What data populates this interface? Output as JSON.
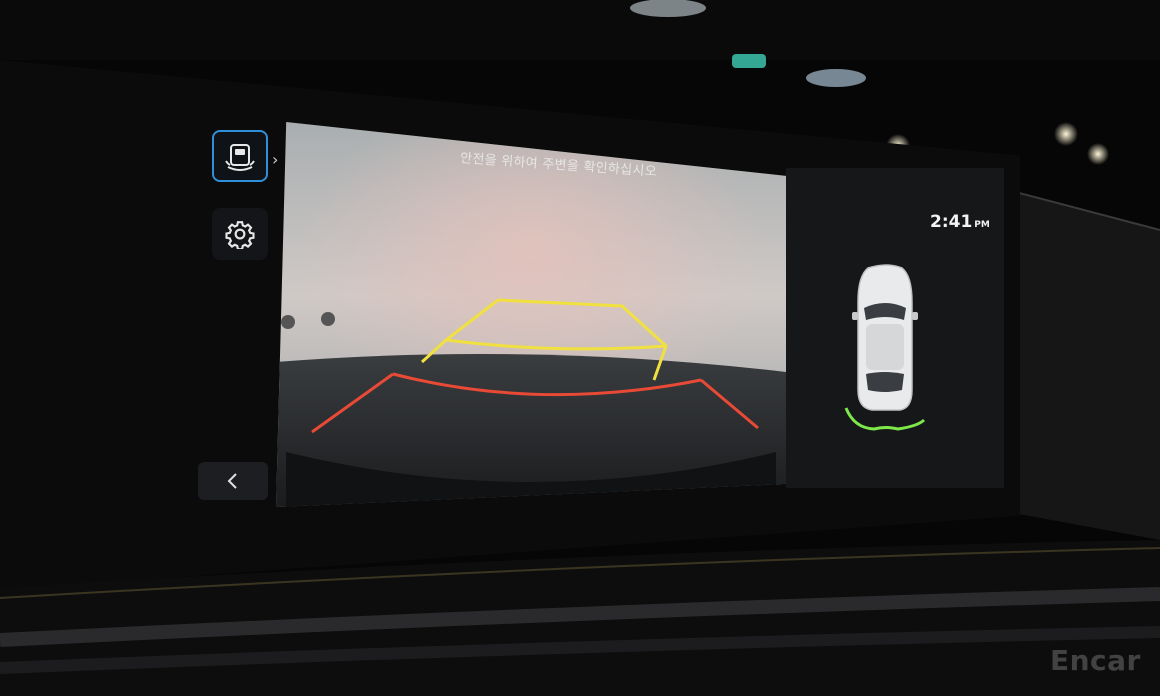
{
  "camera": {
    "message": "안전을 위하여 주변을 확인하십시오",
    "guide_colors": {
      "far": "#f0e040",
      "near": "#e84a35"
    }
  },
  "side_menu": {
    "sensor_icon": "parking-sensor-icon",
    "settings_icon": "gear-icon",
    "back_icon": "chevron-left-icon",
    "accent": "#2f8fd8"
  },
  "status": {
    "time": "2:41",
    "ampm": "PM"
  },
  "vehicle_view": {
    "car_icon": "top-view-car-icon",
    "rear_sensor_color": "#7ee84a"
  },
  "watermark": "Encar"
}
